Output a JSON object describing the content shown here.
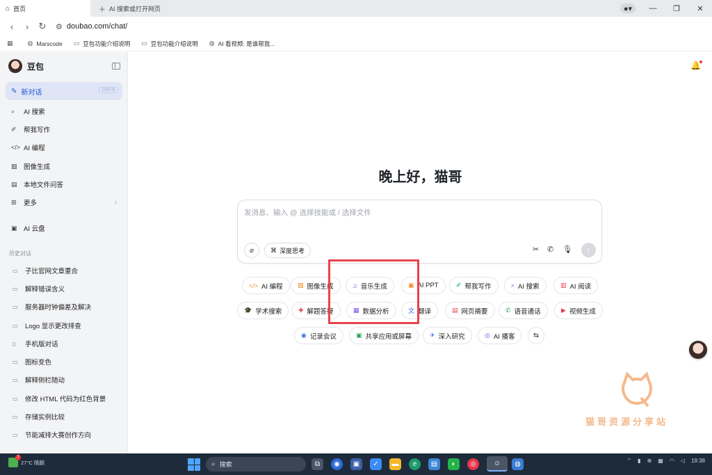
{
  "browser": {
    "active_tab": "首页",
    "new_tab": "AI 搜索或打开网页",
    "url": "doubao.com/chat/",
    "bookmarks": [
      "Marscode",
      "豆包功能介绍说明",
      "豆包功能介绍说明",
      "AI 看视频: 是谁帮我..."
    ],
    "window_controls": [
      "—",
      "❐",
      "✕"
    ]
  },
  "sidebar": {
    "brand": "豆包",
    "new_chat": "新对话",
    "new_chat_shortcut": "Ctrl+K",
    "items": [
      {
        "label": "AI 搜索",
        "icon": "search-icon"
      },
      {
        "label": "帮我写作",
        "icon": "pen-icon"
      },
      {
        "label": "AI 编程",
        "icon": "code-icon"
      },
      {
        "label": "图像生成",
        "icon": "image-icon"
      },
      {
        "label": "本地文件问答",
        "icon": "file-icon"
      },
      {
        "label": "更多",
        "icon": "grid-icon"
      }
    ],
    "cloud": "AI 云盘",
    "history_title": "历史对话",
    "history": [
      "子比官网文章重合",
      "解释错误含义",
      "服务器时钟偏差及解决",
      "Logo 显示更改排查",
      "手机版对话",
      "图标变色",
      "解释侧栏随动",
      "修改 HTML 代码为红色背景",
      "存储实例比较",
      "节能减排大赛创作方向"
    ]
  },
  "main": {
    "greeting": "晚上好，猫哥",
    "placeholder": "发消息、输入 @ 选择技能或 / 选择文件",
    "deep_think": "深度思考",
    "chips_row1": [
      "AI 编程",
      "图像生成",
      "音乐生成",
      "AI PPT",
      "帮我写作",
      "AI 搜索",
      "AI 阅读"
    ],
    "chips_row2": [
      "学术搜索",
      "解题答疑",
      "数据分析",
      "翻译",
      "网页摘要",
      "语音通话",
      "视频生成"
    ],
    "chips_row3": [
      "记录会议",
      "共享应用或屏幕",
      "深入研究",
      "AI 播客"
    ],
    "chip_colors": {
      "code": "#f08a24",
      "image": "#f08a24",
      "music": "#7a4cf0",
      "ppt": "#f08a24",
      "write": "#23a55a",
      "search": "#3b6cf0",
      "read": "#e8434d",
      "academic": "#3b6cf0",
      "solve": "#e8434d",
      "data": "#7a4cf0",
      "translate": "#3b6cf0",
      "summary": "#e8434d",
      "call": "#23a55a",
      "video": "#e8434d",
      "meeting": "#3b6cf0",
      "share": "#23a55a",
      "research": "#3b6cf0",
      "podcast": "#7a4cf0"
    }
  },
  "watermark": {
    "text": "猫哥资源分享站",
    "color": "#f5b98c"
  },
  "taskbar": {
    "search": "搜索",
    "weather": "27°C 晴朗",
    "badge": "7",
    "time": "19:38"
  }
}
